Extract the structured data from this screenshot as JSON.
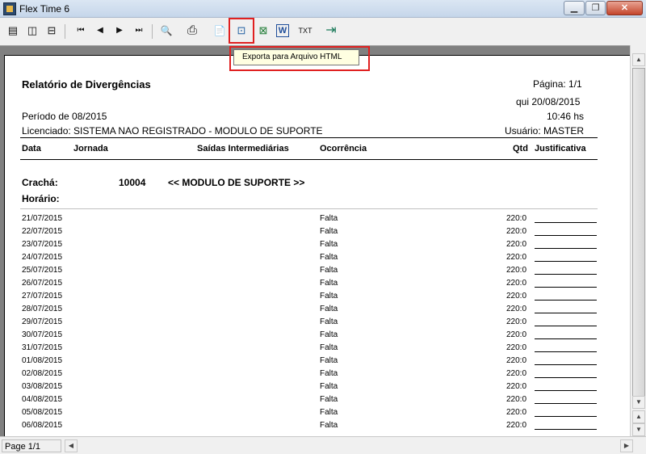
{
  "window": {
    "title": "Flex Time 6"
  },
  "toolbar": {
    "buttons": [
      {
        "name": "view-one-page-icon",
        "glyph": "▤"
      },
      {
        "name": "view-two-pages-icon",
        "glyph": "◫"
      },
      {
        "name": "view-page-width-icon",
        "glyph": "⊟"
      },
      {
        "name": "first-page-icon",
        "glyph": "⏮"
      },
      {
        "name": "previous-page-icon",
        "glyph": "◀"
      },
      {
        "name": "next-page-icon",
        "glyph": "▶"
      },
      {
        "name": "last-page-icon",
        "glyph": "⏭"
      },
      {
        "name": "find-icon",
        "glyph": "🔍"
      },
      {
        "name": "print-icon",
        "glyph": "⎙"
      },
      {
        "name": "export-pdf-icon",
        "glyph": "📄"
      },
      {
        "name": "export-html-icon",
        "glyph": "⊡"
      },
      {
        "name": "export-excel-icon",
        "glyph": "⊠"
      },
      {
        "name": "export-word-icon",
        "glyph": "W"
      },
      {
        "name": "export-txt-icon",
        "glyph": "TXT"
      },
      {
        "name": "exit-icon",
        "glyph": "⇥"
      }
    ],
    "tooltip": "Exporta para Arquivo HTML"
  },
  "report": {
    "title": "Relatório de Divergências",
    "page_label": "Página: 1/1",
    "date": "qui 20/08/2015",
    "time": "10:46 hs",
    "period": "Período de 08/2015",
    "licensee": "Licenciado: SISTEMA NAO REGISTRADO - MODULO DE SUPORTE",
    "user": "Usuário: MASTER",
    "columns": {
      "data": "Data",
      "jornada": "Jornada",
      "saidas": "Saídas Intermediárias",
      "ocorrencia": "Ocorrência",
      "qtd": "Qtd",
      "justificativa": "Justificativa"
    },
    "cracha_label": "Crachá:",
    "cracha_value": "10004",
    "cracha_name": "<< MODULO DE SUPORTE >>",
    "horario_label": "Horário:",
    "rows": [
      {
        "date": "21/07/2015",
        "occurrence": "Falta",
        "qty": "220:0"
      },
      {
        "date": "22/07/2015",
        "occurrence": "Falta",
        "qty": "220:0"
      },
      {
        "date": "23/07/2015",
        "occurrence": "Falta",
        "qty": "220:0"
      },
      {
        "date": "24/07/2015",
        "occurrence": "Falta",
        "qty": "220:0"
      },
      {
        "date": "25/07/2015",
        "occurrence": "Falta",
        "qty": "220:0"
      },
      {
        "date": "26/07/2015",
        "occurrence": "Falta",
        "qty": "220:0"
      },
      {
        "date": "27/07/2015",
        "occurrence": "Falta",
        "qty": "220:0"
      },
      {
        "date": "28/07/2015",
        "occurrence": "Falta",
        "qty": "220:0"
      },
      {
        "date": "29/07/2015",
        "occurrence": "Falta",
        "qty": "220:0"
      },
      {
        "date": "30/07/2015",
        "occurrence": "Falta",
        "qty": "220:0"
      },
      {
        "date": "31/07/2015",
        "occurrence": "Falta",
        "qty": "220:0"
      },
      {
        "date": "01/08/2015",
        "occurrence": "Falta",
        "qty": "220:0"
      },
      {
        "date": "02/08/2015",
        "occurrence": "Falta",
        "qty": "220:0"
      },
      {
        "date": "03/08/2015",
        "occurrence": "Falta",
        "qty": "220:0"
      },
      {
        "date": "04/08/2015",
        "occurrence": "Falta",
        "qty": "220:0"
      },
      {
        "date": "05/08/2015",
        "occurrence": "Falta",
        "qty": "220:0"
      },
      {
        "date": "06/08/2015",
        "occurrence": "Falta",
        "qty": "220:0"
      }
    ]
  },
  "status": {
    "page": "Page 1/1"
  }
}
